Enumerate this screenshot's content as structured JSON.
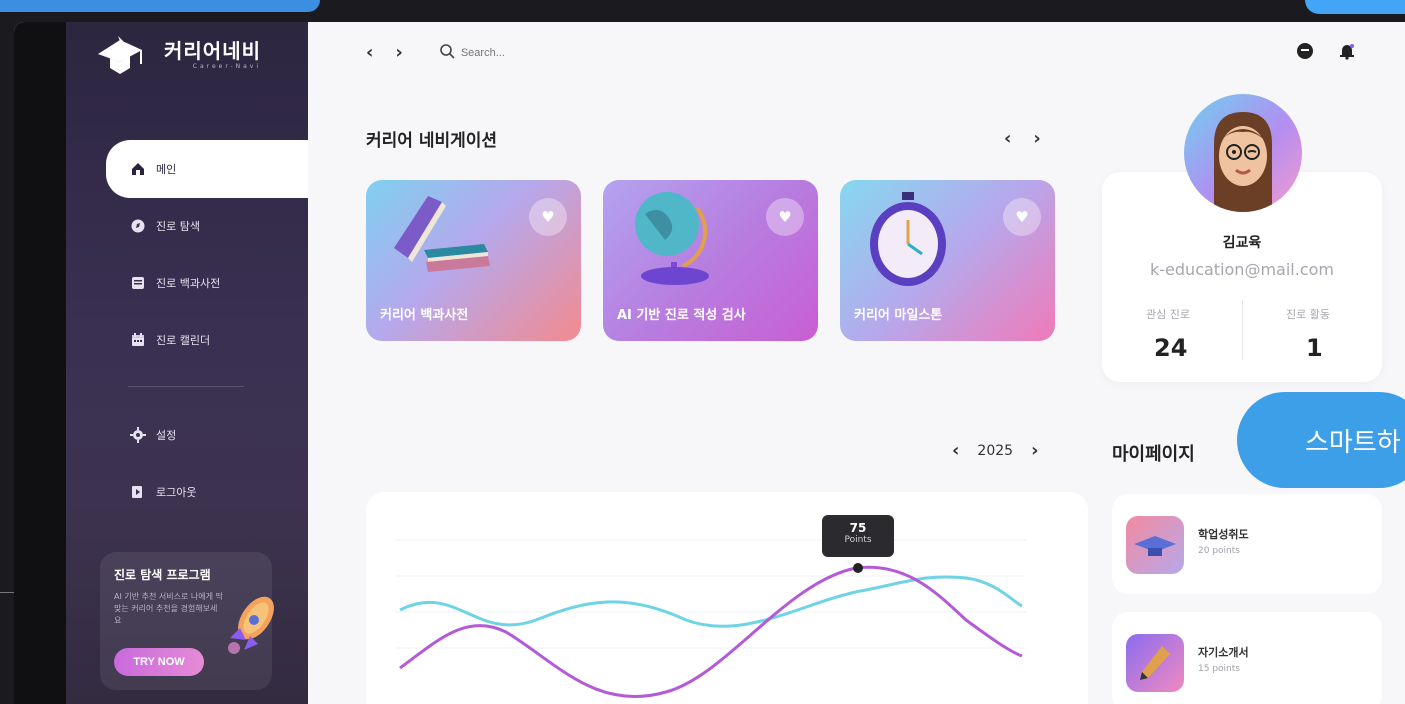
{
  "app": {
    "name": "커리어네비",
    "sub": "Career-Navi"
  },
  "sidebar": {
    "items": [
      {
        "label": "메인",
        "icon": "home-icon",
        "active": true
      },
      {
        "label": "진로 탐색",
        "icon": "compass-icon"
      },
      {
        "label": "진로 백과사전",
        "icon": "book-icon"
      },
      {
        "label": "진로 캘린더",
        "icon": "calendar-icon"
      },
      {
        "label": "설정",
        "icon": "gear-icon"
      },
      {
        "label": "로그아웃",
        "icon": "logout-icon"
      }
    ],
    "promo": {
      "title": "진로 탐색 프로그램",
      "desc": "AI 기반 추천 서비스로 나에게 딱 맞는 커리어 추천을 경험해보세요",
      "button": "TRY NOW"
    }
  },
  "header": {
    "search_placeholder": "Search..."
  },
  "section_title": "커리어 네비게이션",
  "cards": [
    {
      "label": "커리어 백과사전"
    },
    {
      "label": "AI 기반 진로 적성 검사"
    },
    {
      "label": "커리어 마일스톤"
    }
  ],
  "profile": {
    "name": "김교육",
    "email": "k-education@mail.com",
    "stat1_label": "관심 진로",
    "stat1_value": "24",
    "stat2_label": "진로 활동",
    "stat2_value": "1"
  },
  "year": "2025",
  "mypage": {
    "title": "마이페이지",
    "items": [
      {
        "title": "학업성취도",
        "sub": "20 points"
      },
      {
        "title": "자기소개서",
        "sub": "15 points"
      }
    ]
  },
  "smart_button": "스마트하",
  "chart": {
    "tooltip_value": "75",
    "tooltip_unit": "Points"
  },
  "colors": {
    "accent": "#3d9fe8",
    "sidebar": "#2c2640",
    "series1": "#6fd3e6",
    "series2": "#b35ad8"
  }
}
